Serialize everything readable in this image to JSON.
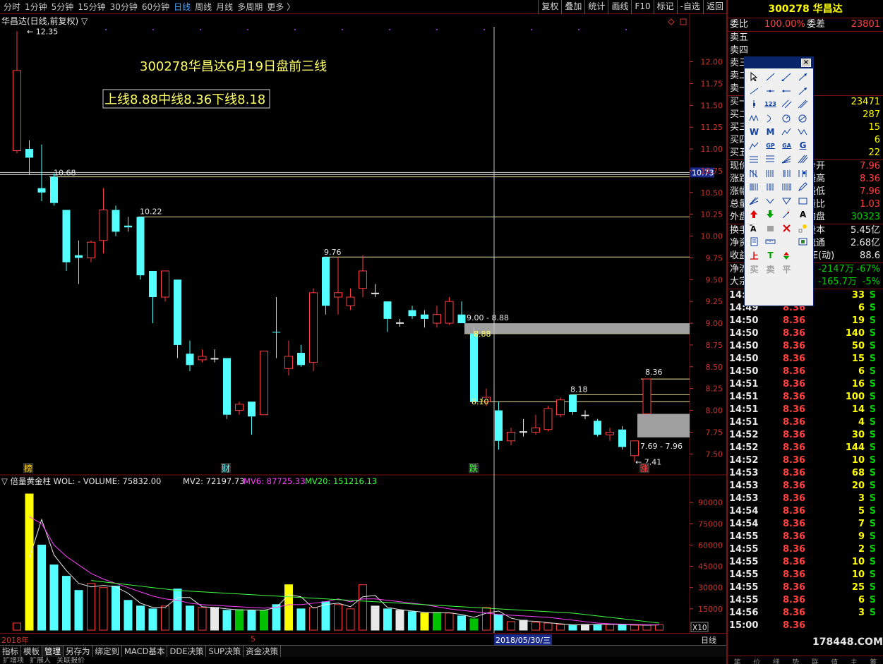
{
  "toolbar": {
    "period_tabs": [
      "分时",
      "1分钟",
      "5分钟",
      "15分钟",
      "30分钟",
      "60分钟",
      "日线",
      "周线",
      "月线",
      "多周期",
      "更多 〉"
    ],
    "active_period": "日线",
    "right_tools": [
      "复权",
      "叠加",
      "统计",
      "画线",
      "F10",
      "标记",
      "-自选",
      "返回"
    ]
  },
  "chart": {
    "header": "华昌达(日线,前复权) ▽",
    "annotation_title": "300278华昌达6月19日盘前三线",
    "annotation_lines": "上线8.88中线8.36下线8.18",
    "high_label": "12.35",
    "low_label": "7.41",
    "price_labels": [
      "10.68",
      "10.22",
      "9.76",
      "9.00 - 8.88",
      "8.88",
      "8.10",
      "8.18",
      "8.36",
      "7.69 - 7.96"
    ],
    "current_price_tag": "10.73",
    "event_markers": [
      "榜",
      "财",
      "跌",
      "涨"
    ],
    "y_axis_ticks": [
      "12.00",
      "11.75",
      "11.50",
      "11.25",
      "11.00",
      "10.75",
      "10.50",
      "10.25",
      "10.00",
      "9.75",
      "9.50",
      "9.25",
      "9.00",
      "8.75",
      "8.50",
      "8.25",
      "8.00",
      "7.75",
      "7.50"
    ]
  },
  "volume": {
    "header": "▽ 倍量黄金柱  WOL: -    VOLUME: 75832.00",
    "mv2": "MV2: 72197.73",
    "mv6": "MV6: 87725.33",
    "mv20": "MV20: 151216.13",
    "y_axis_ticks": [
      "90000",
      "75000",
      "60000",
      "45000",
      "30000",
      "15000"
    ],
    "unit": "X10"
  },
  "date_axis": {
    "left": "2018年",
    "marker": "5",
    "cursor_date": "2018/05/30/三",
    "period": "日线"
  },
  "bottom_tabs": [
    "指标",
    "模板",
    "管理",
    "另存为",
    "绑定到",
    "MACD基本",
    "DDE决策",
    "SUP决策",
    "资金决策"
  ],
  "active_bottom_tab": "管理",
  "bottom_tabs_row2": [
    "扩增项",
    "扩展人",
    "关联报价"
  ],
  "right_panel": {
    "stock_title": "300278 华昌达",
    "weibi_label": "委比",
    "weibi_value": "100.00%",
    "weicha_label": "委差",
    "weicha_value": "23801",
    "sell_rows": [
      "卖五",
      "卖四",
      "卖三",
      "卖二",
      "卖一"
    ],
    "buy_rows": [
      {
        "label": "买一",
        "vol": "23471"
      },
      {
        "label": "买二",
        "vol": "287"
      },
      {
        "label": "买三",
        "vol": "15"
      },
      {
        "label": "买四",
        "vol": "6"
      },
      {
        "label": "买五",
        "vol": "22"
      }
    ],
    "stats": [
      {
        "label": "现价",
        "rlabel": "今开",
        "value": "7.96",
        "cls": "red"
      },
      {
        "label": "涨跌",
        "rlabel": "最高",
        "value": "8.36",
        "cls": "red"
      },
      {
        "label": "涨幅",
        "rlabel": "最低",
        "value": "7.96",
        "cls": "red"
      },
      {
        "label": "总量",
        "rlabel": "量比",
        "value": "1.03",
        "cls": "red"
      },
      {
        "label": "外盘",
        "rlabel": "内盘",
        "value": "30323",
        "cls": "green"
      }
    ],
    "stats2": [
      {
        "label": "换手",
        "rlabel": "股本",
        "value": "5.45亿",
        "cls": "white"
      },
      {
        "label": "净资",
        "rlabel": "流通",
        "value": "2.68亿",
        "cls": "white"
      },
      {
        "label": "收益",
        "rlabel": "PE(动)",
        "value": "88.6",
        "cls": "white"
      }
    ],
    "flow": [
      {
        "label": "净流",
        "value": "-2147万",
        "pct": "-67%"
      },
      {
        "label": "大宗",
        "value": "-165.7万",
        "pct": "-5%"
      }
    ],
    "ticks": [
      {
        "t": "14:49",
        "p": "8.36",
        "v": "33",
        "s": "S"
      },
      {
        "t": "14:49",
        "p": "8.36",
        "v": "6",
        "s": "S"
      },
      {
        "t": "14:50",
        "p": "8.36",
        "v": "19",
        "s": "S"
      },
      {
        "t": "14:50",
        "p": "8.36",
        "v": "140",
        "s": "S"
      },
      {
        "t": "14:50",
        "p": "8.36",
        "v": "50",
        "s": "S"
      },
      {
        "t": "14:50",
        "p": "8.36",
        "v": "15",
        "s": "S"
      },
      {
        "t": "14:50",
        "p": "8.36",
        "v": "6",
        "s": "S"
      },
      {
        "t": "14:51",
        "p": "8.36",
        "v": "16",
        "s": "S"
      },
      {
        "t": "14:51",
        "p": "8.36",
        "v": "100",
        "s": "S"
      },
      {
        "t": "14:51",
        "p": "8.36",
        "v": "14",
        "s": "S"
      },
      {
        "t": "14:51",
        "p": "8.36",
        "v": "4",
        "s": "S"
      },
      {
        "t": "14:52",
        "p": "8.36",
        "v": "30",
        "s": "S"
      },
      {
        "t": "14:52",
        "p": "8.36",
        "v": "144",
        "s": "S"
      },
      {
        "t": "14:52",
        "p": "8.36",
        "v": "10",
        "s": "S"
      },
      {
        "t": "14:53",
        "p": "8.36",
        "v": "68",
        "s": "S"
      },
      {
        "t": "14:53",
        "p": "8.36",
        "v": "20",
        "s": "S"
      },
      {
        "t": "14:53",
        "p": "8.36",
        "v": "3",
        "s": "S"
      },
      {
        "t": "14:54",
        "p": "8.36",
        "v": "5",
        "s": "S"
      },
      {
        "t": "14:54",
        "p": "8.36",
        "v": "7",
        "s": "S"
      },
      {
        "t": "14:55",
        "p": "8.36",
        "v": "9",
        "s": "S"
      },
      {
        "t": "14:55",
        "p": "8.36",
        "v": "2",
        "s": "S"
      },
      {
        "t": "14:55",
        "p": "8.36",
        "v": "10",
        "s": "S"
      },
      {
        "t": "14:55",
        "p": "8.36",
        "v": "10",
        "s": "S"
      },
      {
        "t": "14:55",
        "p": "8.36",
        "v": "25",
        "s": "S"
      },
      {
        "t": "14:55",
        "p": "8.36",
        "v": "6",
        "s": "S"
      },
      {
        "t": "14:56",
        "p": "8.36",
        "v": "3",
        "s": "S"
      },
      {
        "t": "15:00",
        "p": "8.36",
        "v": "",
        "s": ""
      }
    ],
    "watermark": "178448.COM",
    "bottom_tabs": [
      "笔",
      "价",
      "细",
      "势",
      "联",
      "值",
      "主",
      "筹"
    ]
  },
  "palette": {
    "rows": [
      [
        "cursor",
        "line",
        "ray",
        "arrow-line"
      ],
      [
        "segment",
        "dot-line",
        "dot-line2",
        "arrow"
      ],
      [
        "vline",
        "123",
        "parallel",
        "parallel2"
      ],
      [
        "wave",
        "arc",
        "circle",
        "cycle"
      ],
      [
        "W",
        "M",
        "zigzag",
        "zigzag2"
      ],
      [
        "hill",
        "GP",
        "GA",
        "G"
      ],
      [
        "fib",
        "fib2",
        "fan",
        "channel"
      ],
      [
        "bars",
        "bars2",
        "bars3",
        "bars4"
      ],
      [
        "lines",
        "lines2",
        "lines3",
        "pencil"
      ],
      [
        "fan2",
        "down",
        "triangle",
        "rect"
      ],
      [
        "up-arrow",
        "down-arrow",
        "flag",
        "A"
      ],
      [
        "text",
        "gray",
        "delete",
        "light"
      ],
      [
        "note",
        "ruler",
        "",
        "image"
      ],
      [
        "上",
        "T",
        "mark",
        ""
      ],
      [
        "买",
        "卖",
        "平",
        ""
      ]
    ]
  },
  "chart_data": {
    "type": "candlestick",
    "y_price_range": [
      7.3,
      12.45
    ],
    "candles": [
      {
        "o": 10.98,
        "h": 12.35,
        "l": 10.95,
        "c": 11.9,
        "dir": "up"
      },
      {
        "o": 11.0,
        "h": 11.1,
        "l": 10.7,
        "c": 10.9,
        "dir": "down"
      },
      {
        "o": 10.55,
        "h": 11.05,
        "l": 10.4,
        "c": 10.5,
        "dir": "down"
      },
      {
        "o": 10.68,
        "h": 10.72,
        "l": 10.35,
        "c": 10.38,
        "dir": "down"
      },
      {
        "o": 10.3,
        "h": 10.3,
        "l": 9.6,
        "c": 9.7,
        "dir": "down"
      },
      {
        "o": 9.78,
        "h": 9.95,
        "l": 9.45,
        "c": 9.75,
        "dir": "down"
      },
      {
        "o": 9.75,
        "h": 9.95,
        "l": 9.7,
        "c": 9.93,
        "dir": "up"
      },
      {
        "o": 9.95,
        "h": 10.55,
        "l": 9.8,
        "c": 10.3,
        "dir": "up"
      },
      {
        "o": 10.3,
        "h": 10.35,
        "l": 10.0,
        "c": 10.05,
        "dir": "down"
      },
      {
        "o": 10.12,
        "h": 10.22,
        "l": 10.05,
        "c": 10.1,
        "dir": "down"
      },
      {
        "o": 10.22,
        "h": 10.22,
        "l": 9.5,
        "c": 9.55,
        "dir": "down"
      },
      {
        "o": 9.6,
        "h": 9.6,
        "l": 9.0,
        "c": 9.3,
        "dir": "down"
      },
      {
        "o": 9.3,
        "h": 9.6,
        "l": 9.25,
        "c": 9.6,
        "dir": "up"
      },
      {
        "o": 9.5,
        "h": 9.5,
        "l": 8.6,
        "c": 8.75,
        "dir": "down"
      },
      {
        "o": 8.65,
        "h": 8.8,
        "l": 8.45,
        "c": 8.52,
        "dir": "down"
      },
      {
        "o": 8.58,
        "h": 8.7,
        "l": 8.55,
        "c": 8.62,
        "dir": "up"
      },
      {
        "o": 8.6,
        "h": 8.7,
        "l": 8.55,
        "c": 8.6,
        "dir": "flat"
      },
      {
        "o": 8.6,
        "h": 8.6,
        "l": 7.9,
        "c": 7.95,
        "dir": "down"
      },
      {
        "o": 8.0,
        "h": 8.1,
        "l": 7.95,
        "c": 8.07,
        "dir": "up"
      },
      {
        "o": 8.1,
        "h": 8.1,
        "l": 7.72,
        "c": 7.93,
        "dir": "down"
      },
      {
        "o": 7.95,
        "h": 8.68,
        "l": 7.95,
        "c": 8.68,
        "dir": "up"
      },
      {
        "o": 8.9,
        "h": 9.3,
        "l": 8.6,
        "c": 8.9,
        "dir": "down"
      },
      {
        "o": 8.62,
        "h": 8.8,
        "l": 8.4,
        "c": 8.48,
        "dir": "up"
      },
      {
        "o": 8.52,
        "h": 8.75,
        "l": 8.5,
        "c": 8.66,
        "dir": "down"
      },
      {
        "o": 8.55,
        "h": 9.4,
        "l": 8.45,
        "c": 9.35,
        "dir": "up"
      },
      {
        "o": 9.76,
        "h": 9.76,
        "l": 9.1,
        "c": 9.2,
        "dir": "down"
      },
      {
        "o": 9.3,
        "h": 9.76,
        "l": 9.1,
        "c": 9.35,
        "dir": "up"
      },
      {
        "o": 9.3,
        "h": 9.4,
        "l": 9.15,
        "c": 9.2,
        "dir": "up"
      },
      {
        "o": 9.4,
        "h": 9.78,
        "l": 9.3,
        "c": 9.6,
        "dir": "up"
      },
      {
        "o": 9.35,
        "h": 9.45,
        "l": 9.3,
        "c": 9.35,
        "dir": "flat"
      },
      {
        "o": 9.25,
        "h": 9.25,
        "l": 8.9,
        "c": 9.05,
        "dir": "down"
      },
      {
        "o": 9.0,
        "h": 9.05,
        "l": 8.96,
        "c": 9.01,
        "dir": "flat"
      },
      {
        "o": 9.15,
        "h": 9.2,
        "l": 9.05,
        "c": 9.08,
        "dir": "down"
      },
      {
        "o": 9.1,
        "h": 9.15,
        "l": 8.95,
        "c": 9.05,
        "dir": "down"
      },
      {
        "o": 9.0,
        "h": 9.2,
        "l": 8.95,
        "c": 9.1,
        "dir": "up"
      },
      {
        "o": 9.0,
        "h": 9.3,
        "l": 8.98,
        "c": 9.25,
        "dir": "up"
      },
      {
        "o": 9.1,
        "h": 9.25,
        "l": 9.0,
        "c": 9.0,
        "dir": "down"
      },
      {
        "o": 8.88,
        "h": 8.95,
        "l": 8.1,
        "c": 8.1,
        "dir": "down"
      },
      {
        "o": 8.1,
        "h": 8.25,
        "l": 8.05,
        "c": 8.15,
        "dir": "up"
      },
      {
        "o": 8.0,
        "h": 8.1,
        "l": 7.55,
        "c": 7.65,
        "dir": "down"
      },
      {
        "o": 7.65,
        "h": 7.8,
        "l": 7.6,
        "c": 7.75,
        "dir": "up"
      },
      {
        "o": 7.75,
        "h": 7.9,
        "l": 7.7,
        "c": 7.76,
        "dir": "flat"
      },
      {
        "o": 7.75,
        "h": 7.95,
        "l": 7.72,
        "c": 7.8,
        "dir": "up"
      },
      {
        "o": 7.78,
        "h": 8.05,
        "l": 7.76,
        "c": 8.02,
        "dir": "up"
      },
      {
        "o": 7.95,
        "h": 8.15,
        "l": 7.92,
        "c": 8.12,
        "dir": "up"
      },
      {
        "o": 8.18,
        "h": 8.18,
        "l": 7.95,
        "c": 7.98,
        "dir": "down"
      },
      {
        "o": 7.95,
        "h": 8.0,
        "l": 7.9,
        "c": 7.94,
        "dir": "flat"
      },
      {
        "o": 7.88,
        "h": 7.9,
        "l": 7.7,
        "c": 7.72,
        "dir": "down"
      },
      {
        "o": 7.75,
        "h": 7.8,
        "l": 7.65,
        "c": 7.72,
        "dir": "up"
      },
      {
        "o": 7.78,
        "h": 7.82,
        "l": 7.55,
        "c": 7.58,
        "dir": "down"
      },
      {
        "o": 7.48,
        "h": 7.65,
        "l": 7.41,
        "c": 7.65,
        "dir": "up"
      },
      {
        "o": 7.96,
        "h": 8.36,
        "l": 7.96,
        "c": 8.36,
        "dir": "up"
      }
    ],
    "volumes": [
      5000,
      96000,
      60000,
      46000,
      38000,
      28000,
      33000,
      30000,
      31000,
      21000,
      17000,
      15000,
      17000,
      29000,
      17000,
      16000,
      16000,
      14000,
      14500,
      14000,
      14000,
      18000,
      32000,
      15000,
      16000,
      20000,
      18000,
      15000,
      32000,
      17000,
      15000,
      14000,
      13000,
      12000,
      12500,
      12000,
      10000,
      8000,
      16000,
      11000,
      6000,
      7000,
      5500,
      5000,
      4000,
      3500,
      4000,
      4000,
      4200,
      3800,
      3500,
      3500,
      3800
    ],
    "volume_range": [
      0,
      100000
    ],
    "mv6": [
      null,
      80000,
      75000,
      60000,
      52000,
      46000,
      40000,
      36000,
      33000,
      30000,
      27000,
      24000,
      22000,
      21000,
      19000,
      18000,
      17500,
      17000,
      16500,
      16000,
      15500,
      16000,
      18000,
      18000,
      19000,
      20000,
      22000,
      20000,
      22000,
      22000,
      21000,
      20000,
      19000,
      18000,
      16500,
      15000,
      14000,
      13000,
      12000,
      11000,
      10500,
      10000,
      9500,
      9000,
      8000,
      7000,
      6000,
      5000,
      4500,
      4200,
      4000,
      3800,
      3800
    ],
    "mv20": [
      null,
      null,
      null,
      null,
      null,
      null,
      35000,
      34000,
      33000,
      32000,
      31000,
      30000,
      29000,
      28000,
      27500,
      27000,
      26500,
      26000,
      25500,
      25000,
      24500,
      24000,
      23500,
      23000,
      22500,
      22000,
      21500,
      21000,
      20500,
      20000,
      19500,
      19000,
      18500,
      18000,
      17500,
      17000,
      16500,
      16000,
      15500,
      15000,
      14500,
      14000,
      13500,
      13000,
      12500,
      12000,
      11000,
      10000,
      9000,
      8000,
      7000,
      6000,
      5000
    ],
    "highlighted_volume_bars": [
      1,
      22,
      33
    ],
    "green_volume_bars": [
      18,
      20,
      34,
      37
    ],
    "horizontal_levels": [
      10.68,
      10.22,
      9.76,
      8.88,
      8.36,
      8.18,
      8.1
    ],
    "gray_zones": [
      [
        8.88,
        9.0
      ],
      [
        7.69,
        7.96
      ]
    ]
  }
}
